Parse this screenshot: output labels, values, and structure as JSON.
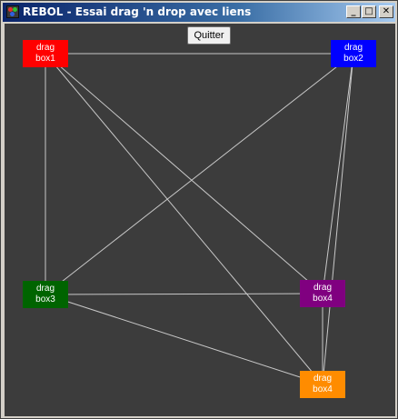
{
  "window": {
    "title": "REBOL - Essai drag 'n drop avec liens",
    "controls": {
      "minimize": "_",
      "maximize": "□",
      "close": "✕"
    }
  },
  "toolbar": {
    "quit_label": "Quitter"
  },
  "boxes": [
    {
      "line1": "drag",
      "line2": "box1",
      "color": "#ff0000"
    },
    {
      "line1": "drag",
      "line2": "box2",
      "color": "#0000ff"
    },
    {
      "line1": "drag",
      "line2": "box3",
      "color": "#006400"
    },
    {
      "line1": "drag",
      "line2": "box4",
      "color": "#800080"
    },
    {
      "line1": "drag",
      "line2": "box4",
      "color": "#ff8c00"
    }
  ],
  "links": [
    [
      0,
      1
    ],
    [
      0,
      2
    ],
    [
      0,
      3
    ],
    [
      0,
      4
    ],
    [
      1,
      2
    ],
    [
      1,
      3
    ],
    [
      1,
      4
    ],
    [
      2,
      3
    ],
    [
      2,
      4
    ],
    [
      3,
      4
    ]
  ],
  "link_color": "#c8c8c8",
  "background_color": "#3c3c3c"
}
